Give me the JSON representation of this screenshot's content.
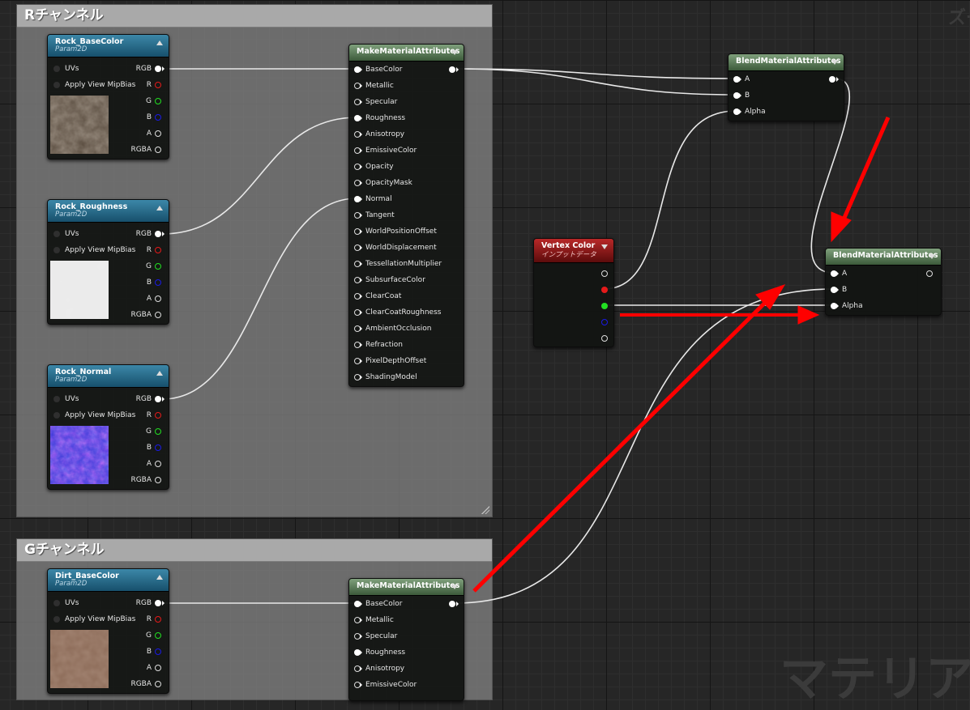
{
  "watermarks": {
    "top_right": "ズー",
    "bottom_right": "マテリア"
  },
  "comments": {
    "r": "Rチャンネル",
    "g": "Gチャンネル"
  },
  "texture_nodes": [
    {
      "title": "Rock_BaseColor",
      "subtitle": "Param2D",
      "thumbnail": "rock-basecolor"
    },
    {
      "title": "Rock_Roughness",
      "subtitle": "Param2D",
      "thumbnail": "rock-roughness"
    },
    {
      "title": "Rock_Normal",
      "subtitle": "Param2D",
      "thumbnail": "rock-normal"
    },
    {
      "title": "Dirt_BaseColor",
      "subtitle": "Param2D",
      "thumbnail": "dirt-basecolor"
    }
  ],
  "texture_pins": {
    "uvs": "UVs",
    "mip": "Apply View MipBias",
    "rgb": "RGB",
    "r": "R",
    "g": "G",
    "b": "B",
    "a": "A",
    "rgba": "RGBA"
  },
  "make_nodes": [
    {
      "title": "MakeMaterialAttributes",
      "inputs": [
        "BaseColor",
        "Metallic",
        "Specular",
        "Roughness",
        "Anisotropy",
        "EmissiveColor",
        "Opacity",
        "OpacityMask",
        "Normal",
        "Tangent",
        "WorldPositionOffset",
        "WorldDisplacement",
        "TessellationMultiplier",
        "SubsurfaceColor",
        "ClearCoat",
        "ClearCoatRoughness",
        "AmbientOcclusion",
        "Refraction",
        "PixelDepthOffset",
        "ShadingModel"
      ]
    },
    {
      "title": "MakeMaterialAttributes",
      "inputs": [
        "BaseColor",
        "Metallic",
        "Specular",
        "Roughness",
        "Anisotropy",
        "EmissiveColor"
      ]
    }
  ],
  "blend_nodes": [
    {
      "title": "BlendMaterialAttributes",
      "inputs": [
        "A",
        "B",
        "Alpha"
      ]
    },
    {
      "title": "BlendMaterialAttributes",
      "inputs": [
        "A",
        "B",
        "Alpha"
      ]
    }
  ],
  "vertex_color": {
    "title": "Vertex Color",
    "subtitle": "インプットデータ"
  },
  "colors": {
    "graph_bg": "#262626",
    "texture_header": "#2a6c8c",
    "make_header": "#5f805c",
    "vertex_header": "#9a1a1a",
    "annotation_arrow": "#ff0000",
    "pin_r": "#e51a1a",
    "pin_g": "#22e022",
    "pin_b": "#1a1ae5"
  }
}
